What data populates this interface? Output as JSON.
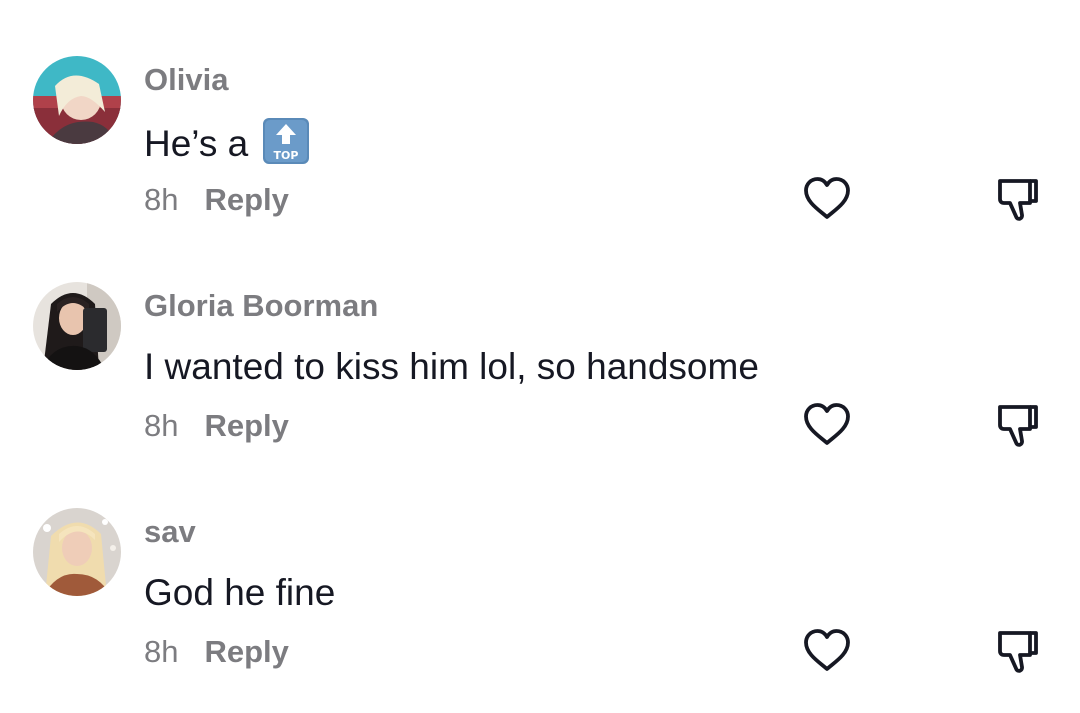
{
  "comments": [
    {
      "username": "Olivia",
      "text": "He’s a",
      "emoji": "top-arrow-emoji",
      "time": "8h",
      "reply_label": "Reply",
      "avatar": "avatar-olivia"
    },
    {
      "username": "Gloria Boorman",
      "text": "I wanted to kiss him lol, so handsome",
      "time": "8h",
      "reply_label": "Reply",
      "avatar": "avatar-gloria"
    },
    {
      "username": "sav",
      "text": "God he fine",
      "time": "8h",
      "reply_label": "Reply",
      "avatar": "avatar-sav"
    }
  ],
  "icons": {
    "like": "heart-outline-icon",
    "dislike": "thumbs-down-outline-icon"
  },
  "colors": {
    "username": "#7c7c80",
    "text": "#161823",
    "icon": "#161823",
    "emoji_bg": "#5a8ab8"
  }
}
